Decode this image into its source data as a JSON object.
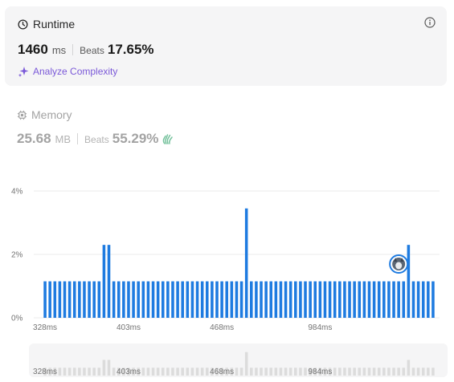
{
  "runtime": {
    "title": "Runtime",
    "value": "1460",
    "unit": "ms",
    "beats_label": "Beats",
    "beats_value": "17.65%",
    "analyze_label": "Analyze Complexity"
  },
  "memory": {
    "title": "Memory",
    "value": "25.68",
    "unit": "MB",
    "beats_label": "Beats",
    "beats_value": "55.29%"
  },
  "colors": {
    "bar": "#1e7be0",
    "mini_bar": "#dcdcdc",
    "accent_purple": "#7a58d8",
    "clap_green": "#76c29d"
  },
  "chart_data": {
    "type": "bar",
    "ylim": [
      0,
      4
    ],
    "y_ticks": [
      "0%",
      "2%",
      "4%"
    ],
    "x_tick_labels": [
      "328ms",
      "403ms",
      "468ms",
      "984ms"
    ],
    "values": [
      1.15,
      1.15,
      1.15,
      1.15,
      1.15,
      1.15,
      1.15,
      1.15,
      1.15,
      1.15,
      1.15,
      1.15,
      2.3,
      2.3,
      1.15,
      1.15,
      1.15,
      1.15,
      1.15,
      1.15,
      1.15,
      1.15,
      1.15,
      1.15,
      1.15,
      1.15,
      1.15,
      1.15,
      1.15,
      1.15,
      1.15,
      1.15,
      1.15,
      1.15,
      1.15,
      1.15,
      1.15,
      1.15,
      1.15,
      1.15,
      1.15,
      3.45,
      1.15,
      1.15,
      1.15,
      1.15,
      1.15,
      1.15,
      1.15,
      1.15,
      1.15,
      1.15,
      1.15,
      1.15,
      1.15,
      1.15,
      1.15,
      1.15,
      1.15,
      1.15,
      1.15,
      1.15,
      1.15,
      1.15,
      1.15,
      1.15,
      1.15,
      1.15,
      1.15,
      1.15,
      1.15,
      1.15,
      1.15,
      1.15,
      2.3,
      1.15,
      1.15,
      1.15,
      1.15,
      1.15
    ],
    "user_marker_index": 72
  }
}
